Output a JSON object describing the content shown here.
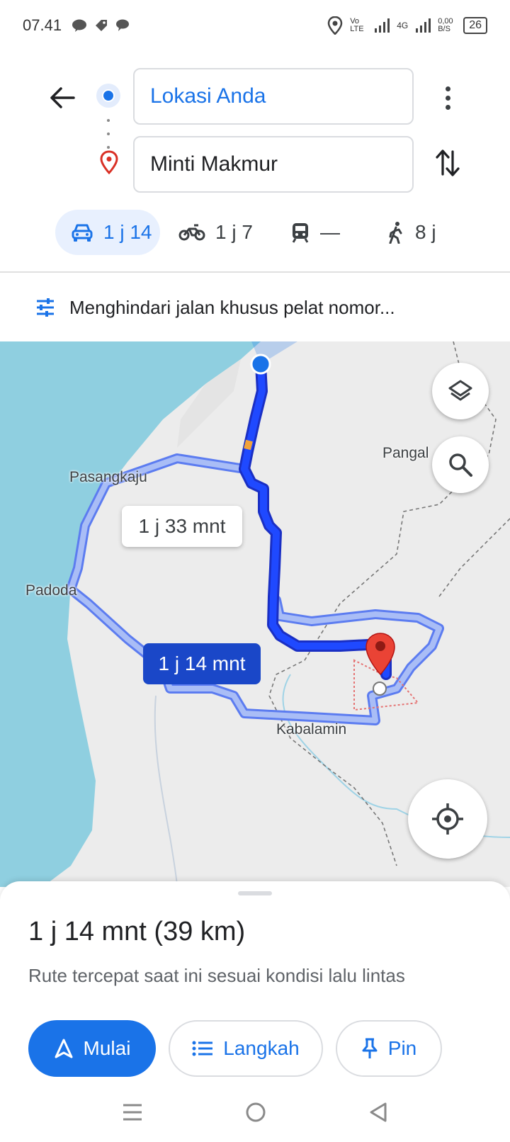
{
  "status_bar": {
    "time": "07.41",
    "network_volte": "Vo LTE",
    "network_4g": "4G",
    "data_speed": "0,00 B/S",
    "battery": "26"
  },
  "directions": {
    "origin": "Lokasi Anda",
    "destination": "Minti Makmur",
    "modes": [
      {
        "name": "car",
        "time": "1 j 14",
        "icon": "car-icon"
      },
      {
        "name": "motorcycle",
        "time": "1 j 7",
        "icon": "motorcycle-icon"
      },
      {
        "name": "transit",
        "time": "—",
        "icon": "train-icon"
      },
      {
        "name": "walk",
        "time": "8 j",
        "icon": "walk-icon"
      }
    ]
  },
  "options": {
    "label": "Menghindari jalan khusus pelat nomor..."
  },
  "map": {
    "labels": {
      "pasangkaju": "Pasangkaju",
      "padoda": "Padoda",
      "kabalamin": "Kabalamin",
      "pangal": "Pangal"
    },
    "eta_alternative": "1 j 33 mnt",
    "eta_selected": "1 j 14 mnt",
    "colors": {
      "water": "#8fcfe0",
      "land": "#ececec",
      "route_main": "#1a3fe0",
      "route_alt": "#8fa9f2",
      "destination_pin": "#e53935"
    }
  },
  "sheet": {
    "summary": "1 j 14 mnt (39 km)",
    "subtitle": "Rute tercepat saat ini sesuai kondisi lalu lintas",
    "start_label": "Mulai",
    "steps_label": "Langkah",
    "pin_label": "Pin"
  }
}
